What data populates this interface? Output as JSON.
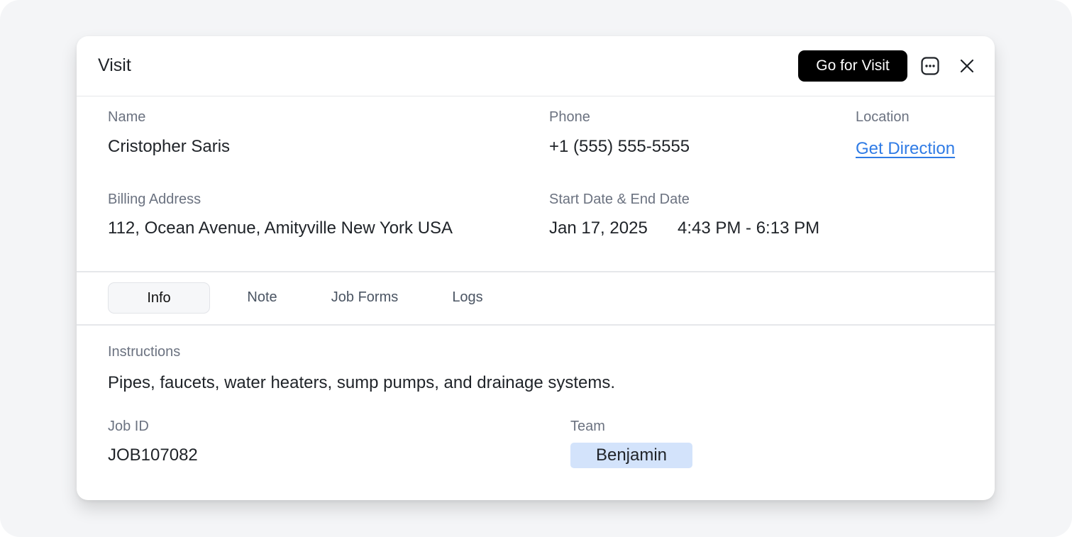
{
  "dialog": {
    "title": "Visit",
    "primary_button": "Go for Visit",
    "chat_icon": "message-dots-icon",
    "close_icon": "close-icon"
  },
  "details": {
    "name_label": "Name",
    "name_value": "Cristopher Saris",
    "phone_label": "Phone",
    "phone_value": "+1 (555) 555-5555",
    "location_label": "Location",
    "location_link": "Get Direction",
    "billing_label": "Billing Address",
    "billing_value": "112, Ocean Avenue, Amityville New York USA",
    "dates_label": "Start Date & End Date",
    "date_value": "Jan 17, 2025",
    "time_value": "4:43 PM - 6:13 PM"
  },
  "tabs": [
    {
      "label": "Info",
      "active": true
    },
    {
      "label": "Note",
      "active": false
    },
    {
      "label": "Job Forms",
      "active": false
    },
    {
      "label": "Logs",
      "active": false
    }
  ],
  "info": {
    "instructions_label": "Instructions",
    "instructions_value": "Pipes, faucets, water heaters, sump pumps, and drainage systems.",
    "job_id_label": "Job ID",
    "job_id_value": "JOB107082",
    "team_label": "Team",
    "team_member": "Benjamin"
  },
  "colors": {
    "link": "#2f7be5",
    "badge_bg": "#d3e3fb",
    "primary_button_bg": "#000000"
  }
}
